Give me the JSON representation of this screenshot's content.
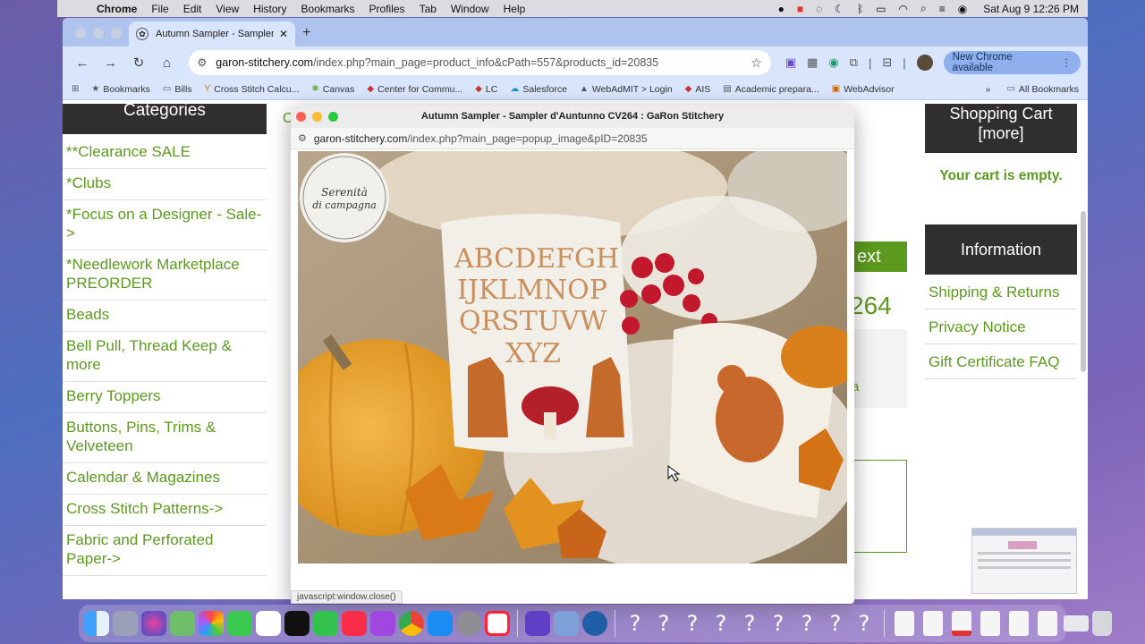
{
  "menubar": {
    "app": "Chrome",
    "items": [
      "File",
      "Edit",
      "View",
      "History",
      "Bookmarks",
      "Profiles",
      "Tab",
      "Window",
      "Help"
    ],
    "clock": "Sat Aug 9  12:26 PM"
  },
  "tab": {
    "title": "Autumn Sampler - Sampler d"
  },
  "omnibox": {
    "host": "garon-stitchery.com",
    "path": "/index.php?main_page=product_info&cPath=557&products_id=20835"
  },
  "update_button": "New Chrome available",
  "bookmarks": {
    "items": [
      "Bookmarks",
      "Bills",
      "Cross Stitch Calcu...",
      "Canvas",
      "Center for Commu...",
      "LC",
      "Salesforce",
      "WebAdMIT > Login",
      "AIS",
      "Academic prepara...",
      "WebAdvisor"
    ],
    "all": "All Bookmarks"
  },
  "sidebar": {
    "heading": "Categories",
    "items": [
      "**Clearance SALE",
      "*Clubs",
      "*Focus on a Designer - Sale->",
      "*Needlework Marketplace PREORDER",
      "Beads",
      "Bell Pull, Thread Keep & more",
      "Berry Toppers",
      "Buttons, Pins, Trims & Velveteen",
      "Calendar & Magazines",
      "Cross Stitch Patterns->",
      "Fabric and Perforated Paper->"
    ]
  },
  "main": {
    "c_fragment": "C",
    "next_fragment": "ext",
    "price_fragment": "264",
    "a_fragment": "a"
  },
  "right": {
    "cart_heading": "Shopping Cart  [more]",
    "cart_empty": "Your cart is empty.",
    "info_heading": "Information",
    "info_items": [
      "Shipping & Returns",
      "Privacy Notice",
      "Gift Certificate FAQ"
    ]
  },
  "popup": {
    "title": "Autumn Sampler - Sampler d'Auntunno CV264 : GaRon Stitchery",
    "url_host": "garon-stitchery.com",
    "url_path": "/index.php?main_page=popup_image&pID=20835",
    "logo_line1": "Serenità",
    "logo_line2": "di campagna",
    "sampler_rows": [
      "ABCDEFGH",
      "IJKLMNOP",
      "QRSTUVW",
      "XYZ"
    ]
  },
  "status_bar": "javascript:window.close()"
}
